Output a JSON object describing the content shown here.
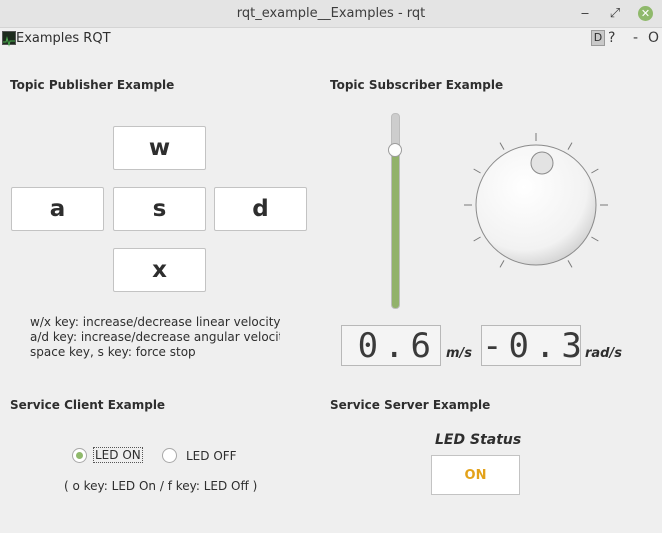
{
  "window": {
    "title": "rqt_example__Examples - rqt",
    "minimize": "‒",
    "restore": "⤢",
    "close": "✕"
  },
  "plugin": {
    "title": "Examples RQT",
    "d_label": "D",
    "help": "?",
    "min": "-",
    "close": "O"
  },
  "publisher": {
    "heading": "Topic Publisher Example",
    "keys": {
      "w": "w",
      "a": "a",
      "s": "s",
      "d": "d",
      "x": "x"
    },
    "help_lines": [
      "w/x key: increase/decrease linear velocity",
      "a/d key: increase/decrease angular velocity",
      "space key, s key: force stop"
    ]
  },
  "subscriber": {
    "heading": "Topic Subscriber Example",
    "slider_level": 0.82,
    "linear_display": "0.6",
    "linear_unit": "m/s",
    "angular_display": "-0.3",
    "angular_unit": "rad/s"
  },
  "client": {
    "heading": "Service Client Example",
    "led_on_label": "LED ON",
    "led_off_label": "LED OFF",
    "selected": "on",
    "hint": "( o key: LED On / f key: LED Off )"
  },
  "server": {
    "heading": "Service Server Example",
    "status_title": "LED Status",
    "status_value": "ON",
    "status_color": "#e3a21a"
  },
  "colors": {
    "accent": "#8fb96b",
    "slider_fill": "#92b26b"
  }
}
